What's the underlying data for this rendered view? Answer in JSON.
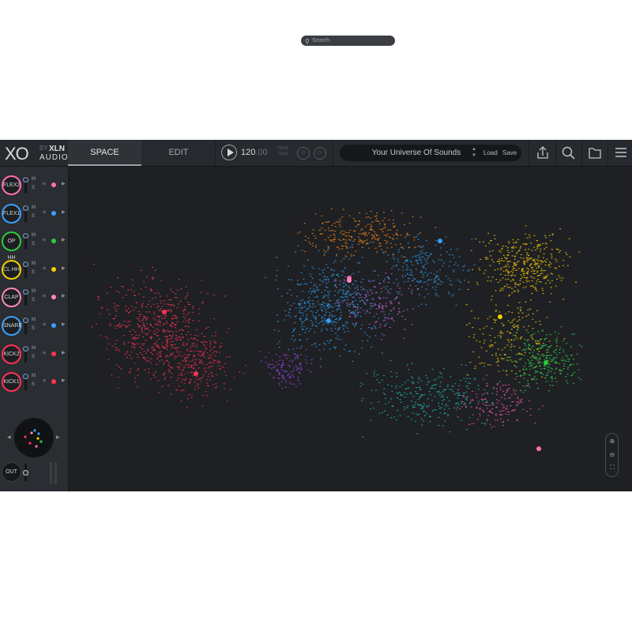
{
  "logo": {
    "xo": "XO",
    "by": "BY",
    "xln": "XLN",
    "audio": "AUDIO"
  },
  "tabs": {
    "space": "SPACE",
    "edit": "EDIT"
  },
  "transport": {
    "bpm": "120",
    "bpm_decimal": ".00",
    "host_line1": "Host",
    "host_line2": "Sync"
  },
  "preset": {
    "name": "Your Universe Of Sounds",
    "load": "Load",
    "save": "Save"
  },
  "toolbar": {
    "icons": [
      "share-icon",
      "search-icon",
      "folder-icon",
      "menu-icon"
    ]
  },
  "channels": [
    {
      "name": "FLEX2",
      "color": "#ff6fb3",
      "m": "M",
      "s": "S"
    },
    {
      "name": "FLEX1",
      "color": "#3aa0ff",
      "m": "M",
      "s": "S"
    },
    {
      "name": "OP HH",
      "color": "#2ecc40",
      "m": "M",
      "s": "S"
    },
    {
      "name": "CL HH",
      "color": "#f5d000",
      "m": "M",
      "s": "S"
    },
    {
      "name": "CLAP",
      "color": "#ff88bb",
      "m": "M",
      "s": "S"
    },
    {
      "name": "SNARE",
      "color": "#3aa0ff",
      "m": "M",
      "s": "S"
    },
    {
      "name": "KICK2",
      "color": "#ff3355",
      "m": "M",
      "s": "S"
    },
    {
      "name": "KICK1",
      "color": "#ff3355",
      "m": "M",
      "s": "S"
    }
  ],
  "output": {
    "label": "OUT"
  },
  "search": {
    "placeholder": "Search"
  },
  "colors": {
    "background": "#1e2023",
    "sidebar": "#2a2d31",
    "topbar": "#262a2e"
  }
}
